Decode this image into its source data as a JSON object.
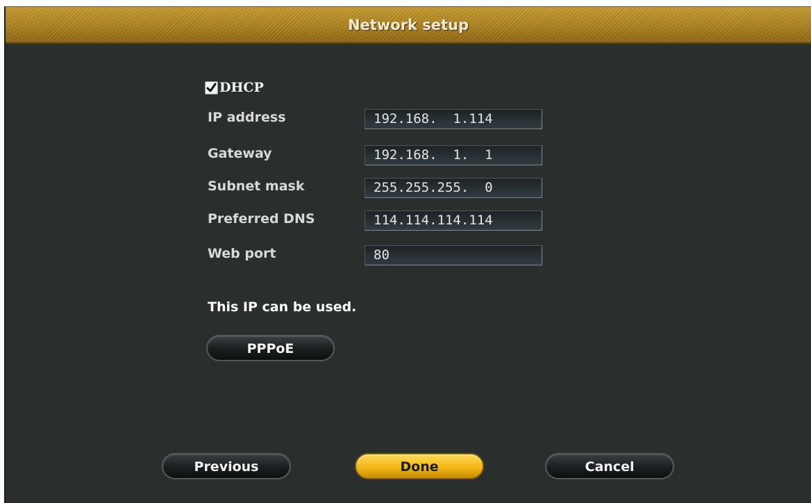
{
  "window": {
    "title": "Network setup"
  },
  "dhcp": {
    "label": "DHCP",
    "checked": true
  },
  "fields": [
    {
      "label": "IP address",
      "value": "192.168.  1.114"
    },
    {
      "label": "Gateway",
      "value": "192.168.  1.  1"
    },
    {
      "label": "Subnet mask",
      "value": "255.255.255.  0"
    },
    {
      "label": "Preferred DNS",
      "value": "114.114.114.114"
    },
    {
      "label": "Web port",
      "value": "80"
    }
  ],
  "status_message": "This IP can be used.",
  "buttons": {
    "pppoe": "PPPoE",
    "previous": "Previous",
    "done": "Done",
    "cancel": "Cancel"
  },
  "colors": {
    "title_bar": "#b08421",
    "background": "#2a2f2e",
    "primary_button": "#f3b716"
  },
  "icons": {
    "dhcp_checkbox": "checkmark-icon"
  }
}
